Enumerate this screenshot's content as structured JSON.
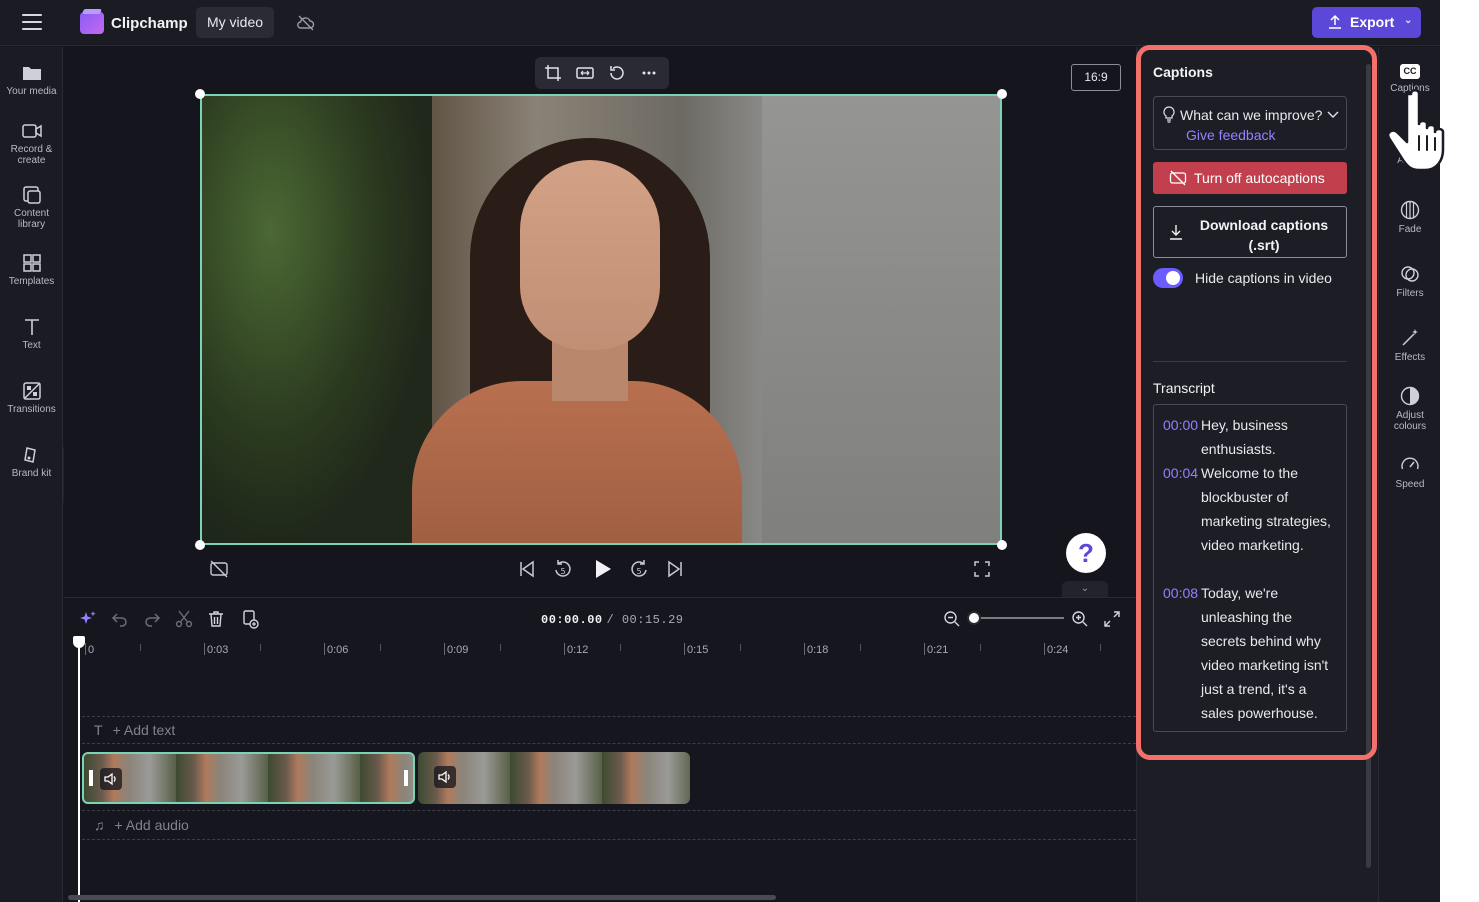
{
  "topbar": {
    "app_name": "Clipchamp",
    "project_title": "My video",
    "export_label": "Export"
  },
  "left_rail": {
    "items": [
      {
        "label": "Your media",
        "icon": "folder-icon"
      },
      {
        "label": "Record & create",
        "icon": "camera-icon"
      },
      {
        "label": "Content library",
        "icon": "library-icon"
      },
      {
        "label": "Templates",
        "icon": "templates-icon"
      },
      {
        "label": "Text",
        "icon": "text-icon"
      },
      {
        "label": "Transitions",
        "icon": "transitions-icon"
      },
      {
        "label": "Brand kit",
        "icon": "brand-kit-icon"
      }
    ]
  },
  "preview": {
    "aspect_ratio": "16:9"
  },
  "timeline": {
    "current_time": "00:00.00",
    "duration": "/ 00:15.29",
    "ruler": [
      "0",
      "0:03",
      "0:06",
      "0:09",
      "0:12",
      "0:15",
      "0:18",
      "0:21",
      "0:24"
    ],
    "add_text": "+ Add text",
    "add_audio": "+ Add audio"
  },
  "captions_panel": {
    "title": "Captions",
    "feedback_question": "What can we improve?",
    "feedback_link": "Give feedback",
    "turn_off_label": "Turn off autocaptions",
    "download_label": "Download captions (.srt)",
    "hide_toggle_label": "Hide captions in video",
    "hide_toggle_on": true,
    "transcript_title": "Transcript",
    "transcript": [
      {
        "time": "00:00",
        "text": "Hey, business enthusiasts."
      },
      {
        "time": "00:04",
        "text": "Welcome to the blockbuster of marketing strategies, video marketing."
      },
      {
        "time": "00:08",
        "text": "Today, we're unleashing the secrets behind why video marketing isn't just a trend, it's a sales powerhouse."
      }
    ]
  },
  "right_rail": {
    "items": [
      {
        "label": "Captions",
        "icon": "captions-icon"
      },
      {
        "label": "Audio",
        "icon": "audio-icon"
      },
      {
        "label": "Fade",
        "icon": "fade-icon"
      },
      {
        "label": "Filters",
        "icon": "filters-icon"
      },
      {
        "label": "Effects",
        "icon": "effects-icon"
      },
      {
        "label": "Adjust colours",
        "icon": "adjust-colours-icon"
      },
      {
        "label": "Speed",
        "icon": "speed-icon"
      }
    ]
  },
  "colors": {
    "accent": "#5b48d8",
    "highlight": "#f4706a",
    "danger": "#c2404d",
    "selection": "#7bd3b5",
    "link": "#8f83ff"
  }
}
